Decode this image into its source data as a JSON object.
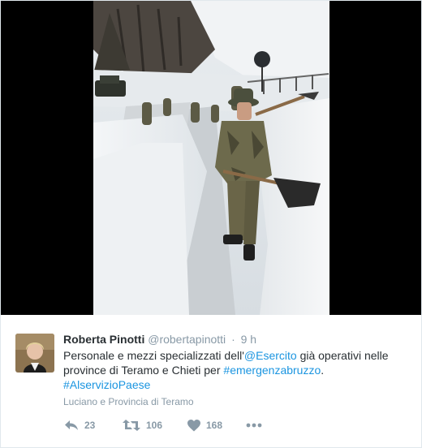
{
  "tweet": {
    "author_name": "Roberta Pinotti",
    "author_handle": "@robertapinotti",
    "separator": "·",
    "time": "9 h",
    "text_parts": {
      "t1": "Personale e mezzi specializzati dell'",
      "mention": "@Esercito",
      "t2": " già operativi nelle province di Teramo e Chieti per ",
      "hashtag1": "#emergenzabruzzo",
      "t3": ". ",
      "hashtag2": "#AlservizioPaese"
    },
    "location": "Luciano e Provincia di Teramo"
  },
  "actions": {
    "reply_count": "23",
    "retweet_count": "106",
    "like_count": "168"
  },
  "icons": {
    "reply": "reply-icon",
    "retweet": "retweet-icon",
    "like": "heart-icon",
    "more": "more-icon"
  },
  "colors": {
    "link": "#1b95e0",
    "text": "#292f33",
    "muted": "#8899a6"
  }
}
